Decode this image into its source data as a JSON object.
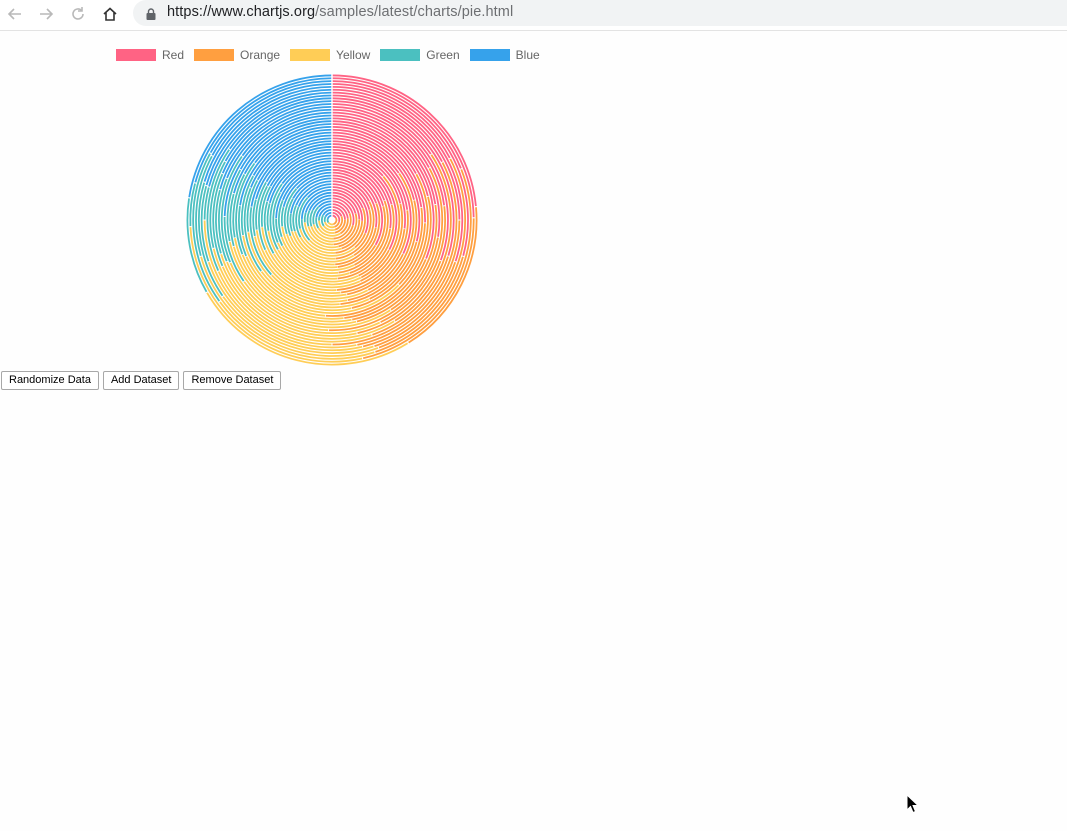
{
  "browser": {
    "url_domain": "https://www.chartjs.org",
    "url_path": "/samples/latest/charts/pie.html"
  },
  "legend": {
    "items": [
      {
        "label": "Red",
        "color": "#ff6384"
      },
      {
        "label": "Orange",
        "color": "#ff9f40"
      },
      {
        "label": "Yellow",
        "color": "#ffcd56"
      },
      {
        "label": "Green",
        "color": "#4bc0c0"
      },
      {
        "label": "Blue",
        "color": "#36a2eb"
      }
    ]
  },
  "chart_data": {
    "type": "pie",
    "labels": [
      "Red",
      "Orange",
      "Yellow",
      "Green",
      "Blue"
    ],
    "colors": [
      "#ff6384",
      "#ff9f40",
      "#ffcd56",
      "#4bc0c0",
      "#36a2eb"
    ],
    "legend_position": "top",
    "datasets_visible": 50,
    "series": [
      {
        "values": [
          28,
          18,
          22,
          12,
          20
        ]
      },
      {
        "values": [
          22,
          24,
          26,
          8,
          20
        ]
      },
      {
        "values": [
          18,
          30,
          20,
          14,
          18
        ]
      },
      {
        "values": [
          30,
          12,
          28,
          10,
          20
        ]
      },
      {
        "values": [
          20,
          26,
          24,
          14,
          16
        ]
      }
    ]
  },
  "controls": {
    "randomize_label": "Randomize Data",
    "add_dataset_label": "Add Dataset",
    "remove_dataset_label": "Remove Dataset"
  }
}
